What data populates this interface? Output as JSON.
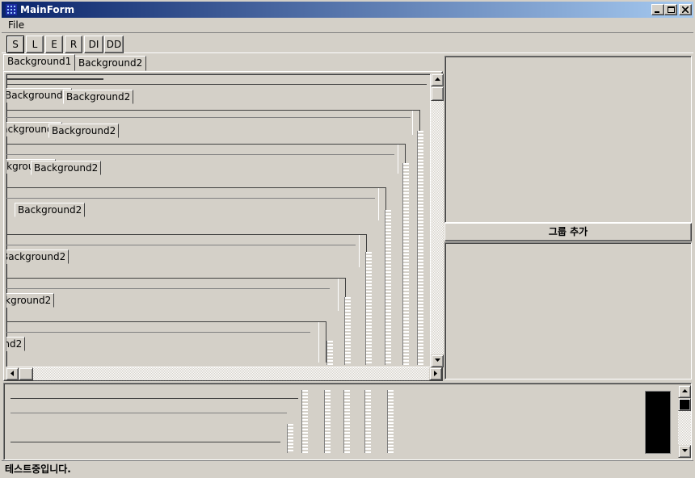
{
  "window": {
    "title": "MainForm",
    "icon": "app-grid-icon"
  },
  "menu": {
    "file": "File"
  },
  "toolbar": {
    "buttons": [
      "S",
      "L",
      "E",
      "R",
      "DI",
      "DD"
    ]
  },
  "tabs": [
    "Background1",
    "Background2"
  ],
  "nested_tabs": {
    "bg1": "Background1",
    "bg2": "Background2"
  },
  "right_panel": {
    "group_add_label": "그룹 추가"
  },
  "status": {
    "text": "테스트중입니다."
  },
  "colors": {
    "titlebar_start": "#0a246a",
    "titlebar_end": "#a6caf0",
    "face": "#d4d0c8"
  }
}
